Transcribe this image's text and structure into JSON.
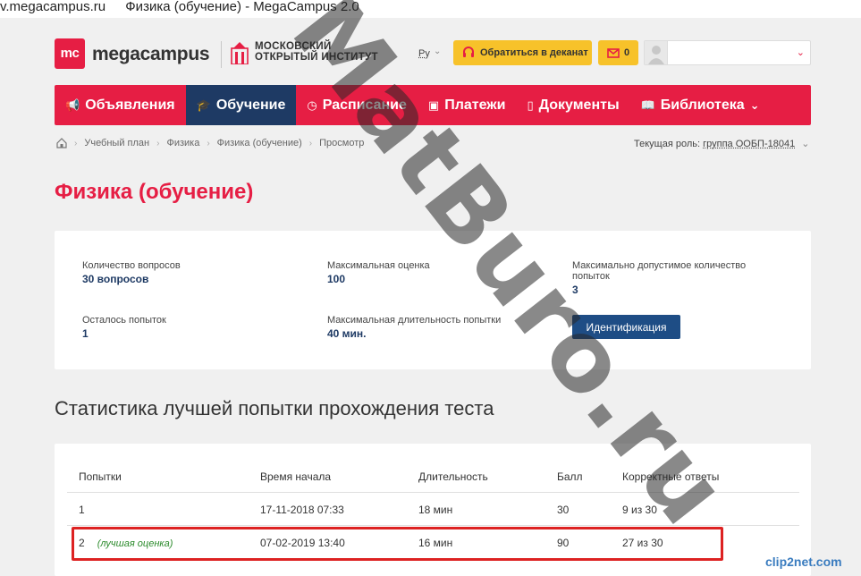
{
  "browser": {
    "url": "v.megacampus.ru",
    "title": "Физика (обучение) - MegaCampus 2.0"
  },
  "header": {
    "logo_mark": "mc",
    "logo_text": "megacampus",
    "institute_line1": "Московский",
    "institute_line2": "открытый институт",
    "lang": "Ру",
    "deanery_button": "Обратиться в деканат",
    "mail_count": "0"
  },
  "nav": {
    "items": [
      {
        "label": "Объявления",
        "icon": "megaphone-icon"
      },
      {
        "label": "Обучение",
        "icon": "graduation-cap-icon",
        "active": true
      },
      {
        "label": "Расписание",
        "icon": "clock-icon"
      },
      {
        "label": "Платежи",
        "icon": "ticket-icon"
      },
      {
        "label": "Документы",
        "icon": "document-icon"
      },
      {
        "label": "Библиотека",
        "icon": "book-icon"
      }
    ]
  },
  "breadcrumbs": [
    "Учебный план",
    "Физика",
    "Физика (обучение)",
    "Просмотр"
  ],
  "role": {
    "label": "Текущая роль:",
    "value": "группа ООБП-18041"
  },
  "page_title": "Физика (обучение)",
  "info": {
    "questions_label": "Количество вопросов",
    "questions_value": "30 вопросов",
    "max_score_label": "Максимальная оценка",
    "max_score_value": "100",
    "max_attempts_label": "Максимально допустимое количество попыток",
    "max_attempts_value": "3",
    "remaining_label": "Осталось попыток",
    "remaining_value": "1",
    "max_duration_label": "Максимальная длительность попытки",
    "max_duration_value": "40 мин.",
    "ident_button": "Идентификация"
  },
  "stats_title": "Статистика лучшей попытки прохождения теста",
  "table": {
    "headers": [
      "Попытки",
      "Время начала",
      "Длительность",
      "Балл",
      "Корректные ответы"
    ],
    "rows": [
      {
        "attempt": "1",
        "note": "",
        "start": "17-11-2018 07:33",
        "duration": "18 мин",
        "score": "30",
        "correct": "9 из 30"
      },
      {
        "attempt": "2",
        "note": "(лучшая оценка)",
        "start": "07-02-2019 13:40",
        "duration": "16 мин",
        "score": "90",
        "correct": "27 из 30"
      }
    ]
  },
  "watermark": "MatBuro.ru",
  "clip2net": "clip2net.com",
  "colors": {
    "brand_red": "#e61e44",
    "nav_active": "#1e3a64",
    "accent_yellow": "#f7c22a",
    "button_blue": "#1e4d85",
    "highlight_red": "#d22222"
  }
}
